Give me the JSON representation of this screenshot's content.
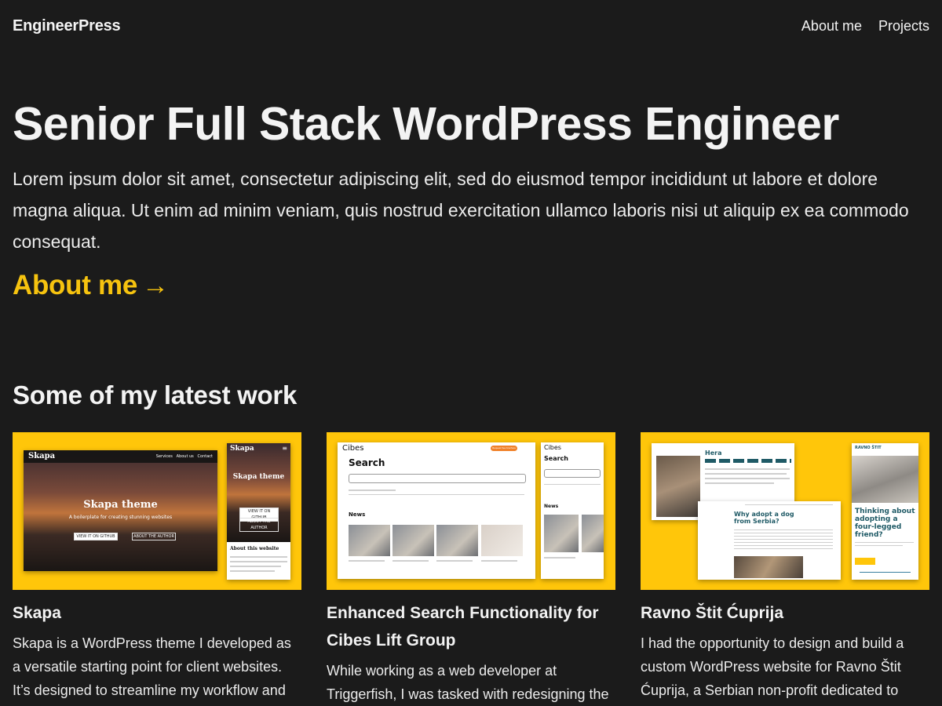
{
  "header": {
    "brand": "EngineerPress",
    "nav": [
      "About me",
      "Projects"
    ]
  },
  "hero": {
    "title": "Senior Full Stack WordPress Engineer",
    "text": "Lorem ipsum dolor sit amet, consectetur adipiscing elit, sed do eiusmod tempor incididunt ut labore et dolore magna aliqua. Ut enim ad minim veniam, quis nostrud exercitation ullamco laboris nisi ut aliquip ex ea commodo consequat.",
    "link_label": "About me",
    "link_arrow": "→"
  },
  "work": {
    "title": "Some of my latest work",
    "projects": [
      {
        "title": "Skapa",
        "description": "Skapa is a WordPress theme I developed as a versatile starting point for client websites. It’s designed to streamline my workflow and",
        "thumb": {
          "logo": "Skapa",
          "nav": "Services   About us   Contact",
          "headline": "Skapa theme",
          "tagline": "A boilerplate for creating stunning websites",
          "btn1": "VIEW IT ON GITHUB",
          "btn2": "ABOUT THE AUTHOR",
          "side_title": "About this website"
        }
      },
      {
        "title": "Enhanced Search Functionality for Cibes Lift Group",
        "description": "While working as a web developer at Triggerfish, I was tasked with redesigning the",
        "thumb": {
          "logo": "Cibes",
          "heading": "Search",
          "section": "News",
          "cta": "Request free brochure"
        }
      },
      {
        "title": "Ravno Štit Ćuprija",
        "description": "I had the opportunity to design and build a custom WordPress website for Ravno Štit Ćuprija, a Serbian non-profit dedicated to",
        "thumb": {
          "name": "Hera",
          "heading": "Why adopt a dog from Serbia?",
          "mobile_heading": "Thinking about adopting a four-legged friend?",
          "logo": "RAVNO ŠTIT"
        }
      }
    ]
  },
  "colors": {
    "background": "#1b1b1b",
    "accent": "#f6c30f",
    "thumb_bg": "#ffc60a",
    "teal": "#1f5a66"
  }
}
